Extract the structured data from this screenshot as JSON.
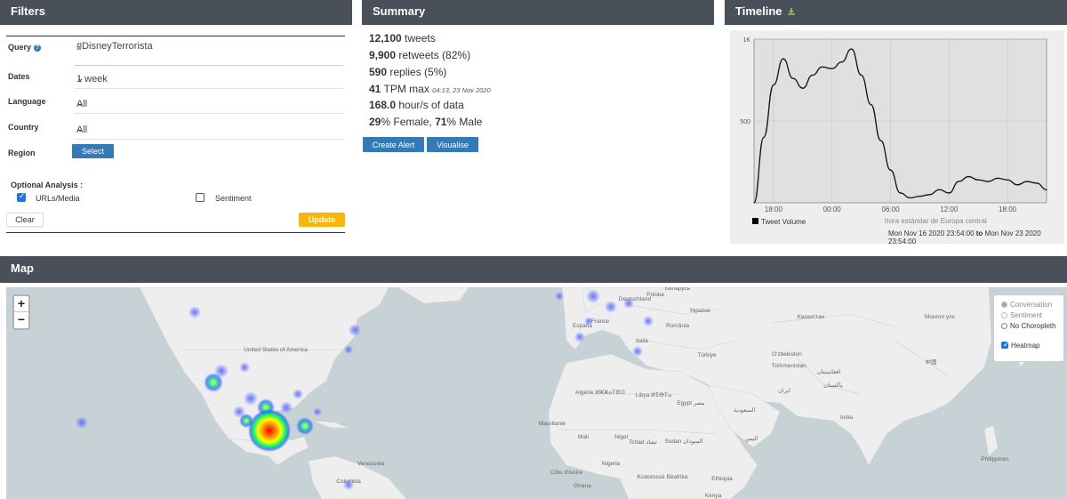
{
  "filters": {
    "title": "Filters",
    "query_label": "Query",
    "query_value": "#DisneyTerrorista",
    "dates_label": "Dates",
    "dates_value": "1 week",
    "language_label": "Language",
    "language_value": "All",
    "country_label": "Country",
    "country_value": "All",
    "region_label": "Region",
    "region_button": "Select",
    "optional_label": "Optional Analysis :",
    "urls_label": "URLs/Media",
    "urls_checked": true,
    "sentiment_label": "Sentiment",
    "sentiment_checked": false,
    "clear_button": "Clear",
    "update_button": "Update"
  },
  "summary": {
    "title": "Summary",
    "tweets_count": "12,100",
    "tweets_label": "tweets",
    "retweets_count": "9,900",
    "retweets_label": "retweets (82%)",
    "replies_count": "590",
    "replies_label": "replies (5%)",
    "tpm_count": "41",
    "tpm_label": "TPM max",
    "tpm_time": "04:13, 23 Nov 2020",
    "hours_count": "168.0",
    "hours_label": "hour/s of data",
    "female_pct": "29",
    "female_label": "% Female,",
    "male_pct": "71",
    "male_label": "% Male",
    "create_alert_button": "Create Alert",
    "visualise_button": "Visualise"
  },
  "timeline": {
    "title": "Timeline",
    "download_icon": "download-icon",
    "legend_label": "Tweet Volume",
    "timezone": "hora estándar de Europa central",
    "range_start": "Mon Nov 16 2020 23:54:00",
    "range_to": "to",
    "range_end": "Mon Nov 23 2020 23:54:00"
  },
  "chart_data": {
    "type": "line",
    "series": [
      {
        "name": "Tweet Volume",
        "x": [
          "16:00",
          "17:00",
          "18:00",
          "19:00",
          "20:00",
          "21:00",
          "22:00",
          "23:00",
          "00:00",
          "01:00",
          "02:00",
          "03:00",
          "04:00",
          "05:00",
          "06:00",
          "07:00",
          "08:00",
          "09:00",
          "10:00",
          "11:00",
          "12:00",
          "13:00",
          "14:00",
          "15:00",
          "16:00",
          "17:00",
          "18:00",
          "19:00",
          "20:00",
          "21:00",
          "22:00"
        ],
        "values": [
          0,
          400,
          720,
          880,
          760,
          700,
          780,
          830,
          820,
          860,
          940,
          780,
          600,
          380,
          200,
          60,
          30,
          40,
          50,
          80,
          60,
          130,
          160,
          140,
          130,
          150,
          140,
          110,
          130,
          120,
          80
        ]
      }
    ],
    "x_tick_labels": [
      "18:00",
      "00:00",
      "06:00",
      "12:00",
      "18:00"
    ],
    "y_tick_labels": [
      "500",
      "1K"
    ],
    "ylim": [
      0,
      1000
    ],
    "grid": true,
    "legend": "bottom-left"
  },
  "map": {
    "title": "Map",
    "zoom_in": "+",
    "zoom_out": "−",
    "layer_conversation": "Conversation",
    "layer_sentiment": "Sentiment",
    "layer_no_choropleth": "No Choropleth",
    "heatmap_label": "Heatmap",
    "heatmap_checked": true,
    "labels": [
      "United States of America",
      "Deutschland",
      "Polska",
      "Беларусь",
      "Україна",
      "Казахстан",
      "Монгол улс",
      "France",
      "România",
      "España",
      "Italia",
      "Türkiye",
      "O'zbekiston",
      "Türkmenistan",
      "中国",
      "افغانستان",
      "پاکستان",
      "ایران",
      "Algérie ⵍⵣⵣⴰⵢⴻⵔ",
      "Libya ⵍⵉⴱⵢⴰ",
      "Egypt مصر",
      "السعودية",
      "Mauritanie",
      "Mali",
      "Niger",
      "Tchad تشاد",
      "Sudan السودان",
      "اليمن",
      "India",
      "Nigeria",
      "Côte d'Ivoire",
      "Kodorossé Bêafrika",
      "Ethiopia",
      "Kenya",
      "Venezuela",
      "Colombia",
      "Philippines",
      "Ghana"
    ]
  }
}
